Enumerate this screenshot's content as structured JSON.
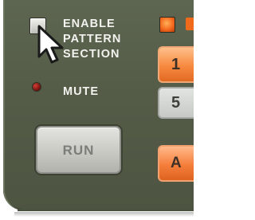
{
  "pattern_section": {
    "checkbox_checked": false,
    "enable_label_lines": [
      "ENABLE",
      "PATTERN",
      "SECTION"
    ],
    "mute_label": "MUTE",
    "mute_led_color": "#7d1410",
    "run_label": "RUN"
  },
  "pattern_buttons": {
    "bank_1_label": "1",
    "bank_5_label": "5",
    "pattern_a_label": "A",
    "active_color": "#f46a1e"
  },
  "cursor": {
    "icon": "arrow-pointer-icon"
  }
}
